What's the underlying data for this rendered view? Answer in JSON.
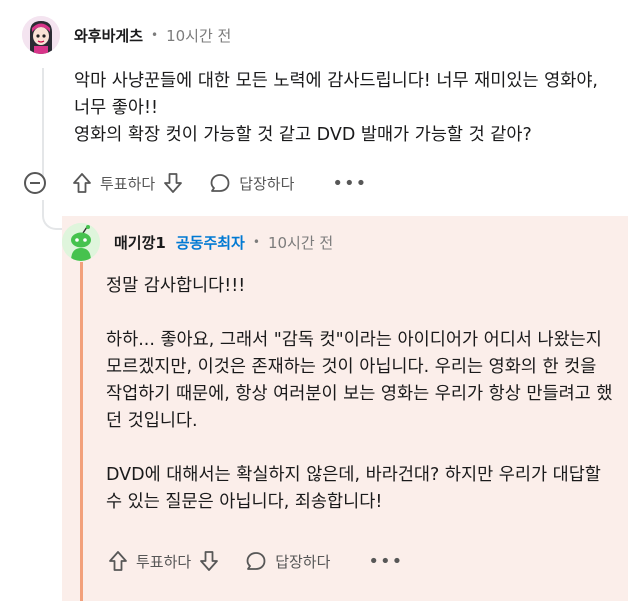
{
  "comment": {
    "author": "와후바게츠",
    "separator": "•",
    "time": "10시간 전",
    "paragraphs": [
      "악마 사냥꾼들에 대한 모든 노력에 감사드립니다! 너무 재미있는 영화야, 너무 좋아!!",
      "영화의 확장 컷이 가능할 것 같고 DVD 발매가 가능할 것 같아?"
    ],
    "actions": {
      "upvote_label": "투표하다",
      "reply_label": "답장하다",
      "more": "•••"
    }
  },
  "reply": {
    "author": "매기깡1",
    "badge": "공동주최자",
    "separator": "•",
    "time": "10시간 전",
    "paragraphs": [
      "정말 감사합니다!!!",
      "하하... 좋아요, 그래서 \"감독 컷\"이라는 아이디어가 어디서 나왔는지 모르겠지만, 이것은 존재하는 것이 아닙니다. 우리는 영화의 한 컷을 작업하기 때문에, 항상 여러분이 보는 영화는 우리가 항상 만들려고 했던 것입니다.",
      "DVD에 대해서는 확실하지 않은데, 바라건대? 하지만 우리가 대답할 수 있는 질문은 아닙니다, 죄송합니다!"
    ],
    "actions": {
      "upvote_label": "투표하다",
      "reply_label": "답장하다",
      "more": "•••"
    }
  },
  "colors": {
    "reply_background": "#fbeeea",
    "accent_bar": "#f2a07b",
    "moderator_badge": "#0079d3",
    "muted_text": "#7c7c7c"
  }
}
